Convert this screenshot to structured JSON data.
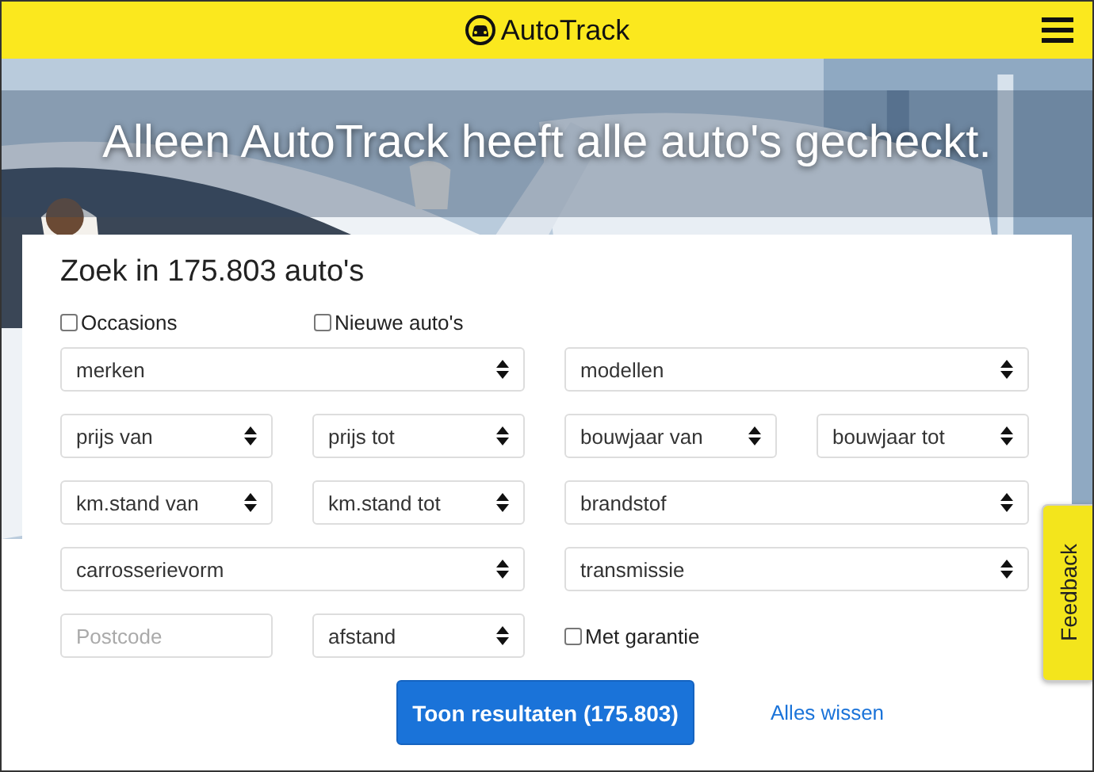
{
  "header": {
    "logo": "**Auto**Track"
  },
  "hero": {
    "headline": "Alleen AutoTrack heeft alle auto's gecheckt."
  },
  "search": {
    "title": "Zoek in 175.803 auto's",
    "types": [
      {
        "label": "Occasions",
        "checked": false
      },
      {
        "label": "Nieuwe auto's",
        "checked": false
      }
    ],
    "fields": [
      {
        "kind": "select",
        "label": "merken",
        "wide": true
      },
      {
        "kind": "select",
        "label": "modellen",
        "wide": true
      },
      {
        "kind": "select",
        "label": "prijs van",
        "wide": false
      },
      {
        "kind": "select",
        "label": "prijs tot",
        "wide": false
      },
      {
        "kind": "select",
        "label": "bouwjaar van",
        "wide": false
      },
      {
        "kind": "select",
        "label": "bouwjaar tot",
        "wide": false
      },
      {
        "kind": "select",
        "label": "km.stand van",
        "wide": false
      },
      {
        "kind": "select",
        "label": "km.stand tot",
        "wide": false
      },
      {
        "kind": "select",
        "label": "brandstof",
        "wide": true
      },
      {
        "kind": "select",
        "label": "carrosserievorm",
        "wide": true
      },
      {
        "kind": "select",
        "label": "transmissie",
        "wide": true
      },
      {
        "kind": "input",
        "placeholder": "Postcode",
        "wide": false
      },
      {
        "kind": "select",
        "label": "afstand",
        "wide": false
      },
      {
        "kind": "checkbox",
        "label": "Met garantie",
        "checked": false
      }
    ],
    "submit": "Toon resultaten (175.803)",
    "reset": "Alles wissen"
  },
  "feedback": "Feedback"
}
